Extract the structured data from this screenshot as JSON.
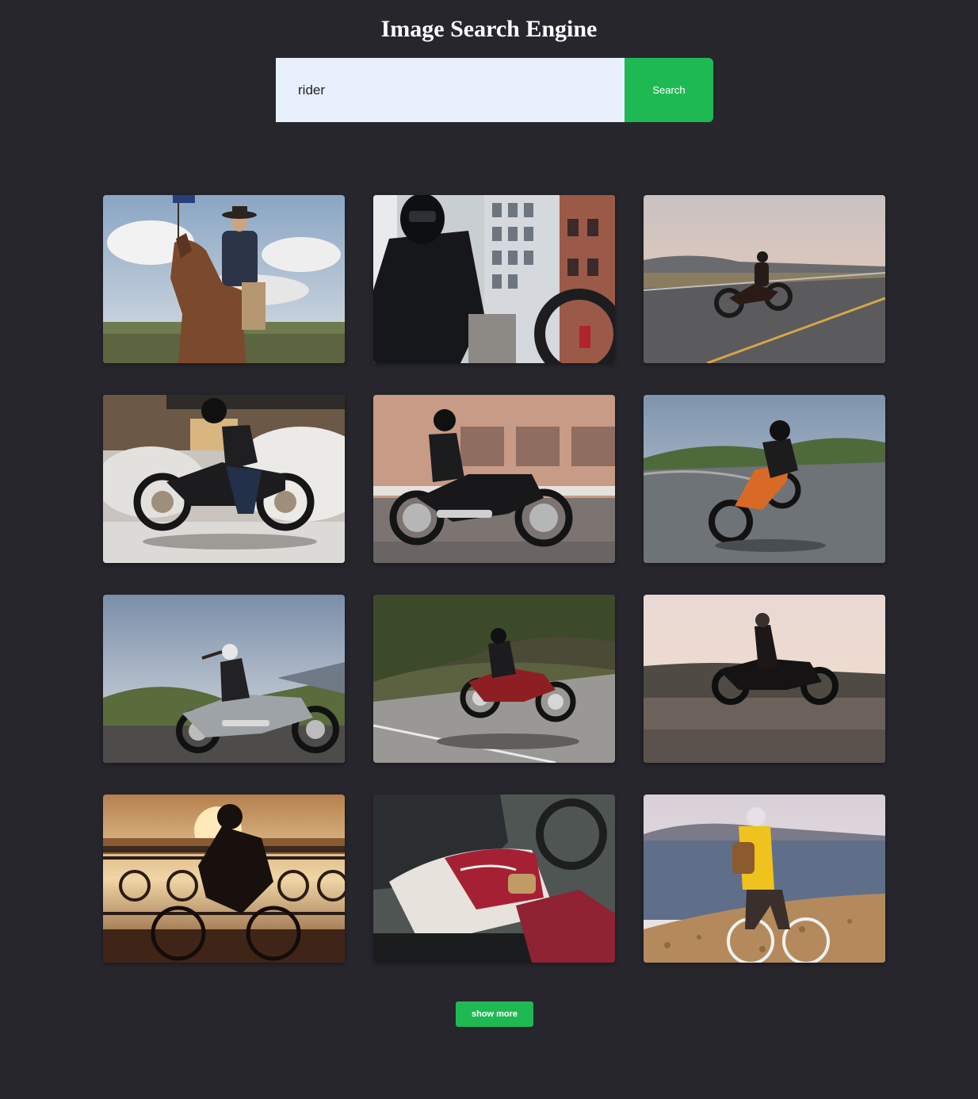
{
  "header": {
    "title": "Image Search Engine"
  },
  "search": {
    "query": "rider",
    "button_label": "Search"
  },
  "results": [
    {
      "scene": "horseback rider with hat and flag under cloudy sky"
    },
    {
      "scene": "helmeted rider on motorcycle in front of city buildings"
    },
    {
      "scene": "motorcyclist riding on highway at dusk"
    },
    {
      "scene": "rider in leather jacket on cruiser motorcycle with smoke"
    },
    {
      "scene": "bearded rider on chrome cruiser beside brick building"
    },
    {
      "scene": "rider leaning orange motorcycle on curved road"
    },
    {
      "scene": "woman riding silver cruiser on open road"
    },
    {
      "scene": "rider on red cruiser motorcycle on countryside road"
    },
    {
      "scene": "rider silhouette on motorcycle at sunset"
    },
    {
      "scene": "cyclist crossing bridge at sunrise"
    },
    {
      "scene": "close-up of rider on red and white motorcycle tank"
    },
    {
      "scene": "cyclist in yellow jacket on pebble beach"
    }
  ],
  "pagination": {
    "show_more_label": "show more"
  },
  "colors": {
    "background": "#27262d",
    "accent": "#1fb954",
    "input_background": "#e8f0fe"
  }
}
